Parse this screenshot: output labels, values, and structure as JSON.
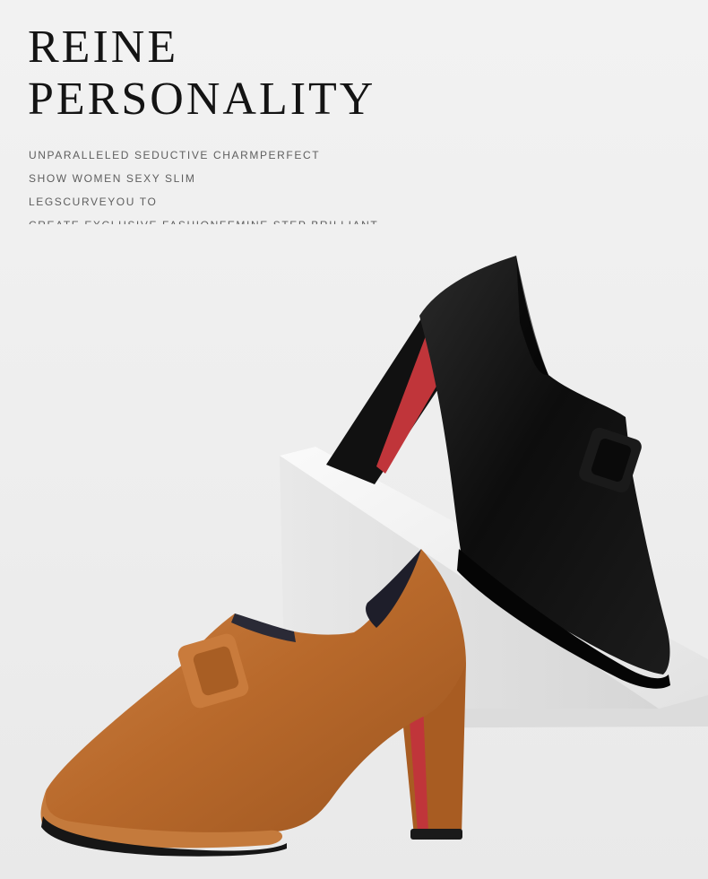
{
  "headline": {
    "line1": "REINE",
    "line2": "PERSONALITY"
  },
  "copy": [
    "UNPARALLELED SEDUCTIVE CHARMPERFECT",
    "SHOW WOMEN SEXY SLIM",
    "LEGSCURVEYOU TO",
    "CREATE EXCLUSIVE FASHIONFEMINE STEP BRILLIANT"
  ],
  "colors": {
    "background": "#efefef",
    "headline": "#141414",
    "copy": "#5e5e5e",
    "black_shoe": "#0c0c0c",
    "tan_shoe": "#b9692a",
    "sole_red": "#c0353a"
  }
}
